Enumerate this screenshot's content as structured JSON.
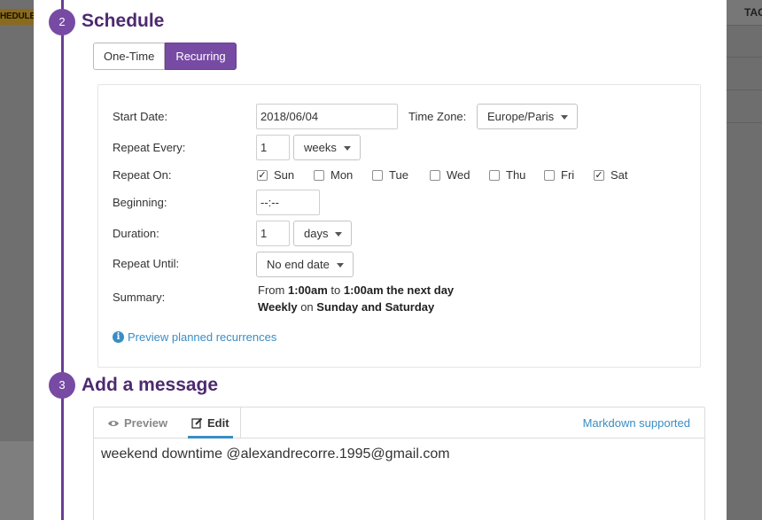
{
  "background": {
    "left_badge": "HEDULE",
    "right_header": "TAG"
  },
  "steps": {
    "schedule": {
      "number": "2",
      "title": "Schedule"
    },
    "message": {
      "number": "3",
      "title": "Add a message"
    }
  },
  "schedule_type": {
    "options": [
      "One-Time",
      "Recurring"
    ],
    "selected": "Recurring"
  },
  "form": {
    "start_date": {
      "label": "Start Date:",
      "value": "2018/06/04"
    },
    "time_zone": {
      "label": "Time Zone:",
      "value": "Europe/Paris"
    },
    "repeat_every": {
      "label": "Repeat Every:",
      "value": "1",
      "unit": "weeks"
    },
    "repeat_on": {
      "label": "Repeat On:",
      "days": [
        {
          "name": "Sun",
          "checked": true
        },
        {
          "name": "Mon",
          "checked": false
        },
        {
          "name": "Tue",
          "checked": false
        },
        {
          "name": "Wed",
          "checked": false
        },
        {
          "name": "Thu",
          "checked": false
        },
        {
          "name": "Fri",
          "checked": false
        },
        {
          "name": "Sat",
          "checked": true
        }
      ]
    },
    "beginning": {
      "label": "Beginning:",
      "value": "--:--"
    },
    "duration": {
      "label": "Duration:",
      "value": "1",
      "unit": "days"
    },
    "repeat_until": {
      "label": "Repeat Until:",
      "value": "No end date"
    },
    "summary": {
      "label": "Summary:",
      "line1": {
        "from": "From",
        "start": "1:00am",
        "to": "to",
        "end": "1:00am the next day"
      },
      "line2": {
        "freq": "Weekly",
        "on": "on",
        "days": "Sunday and Saturday"
      }
    },
    "preview_link": "Preview planned recurrences"
  },
  "editor": {
    "tabs": [
      "Preview",
      "Edit"
    ],
    "active_tab": "Edit",
    "markdown_link": "Markdown supported",
    "message": "weekend downtime @alexandrecorre.1995@gmail.com"
  },
  "colors": {
    "accent_purple": "#774aa4",
    "timeline": "#6b3d97",
    "heading": "#4d2a70",
    "link_blue": "#3a8dc4"
  }
}
